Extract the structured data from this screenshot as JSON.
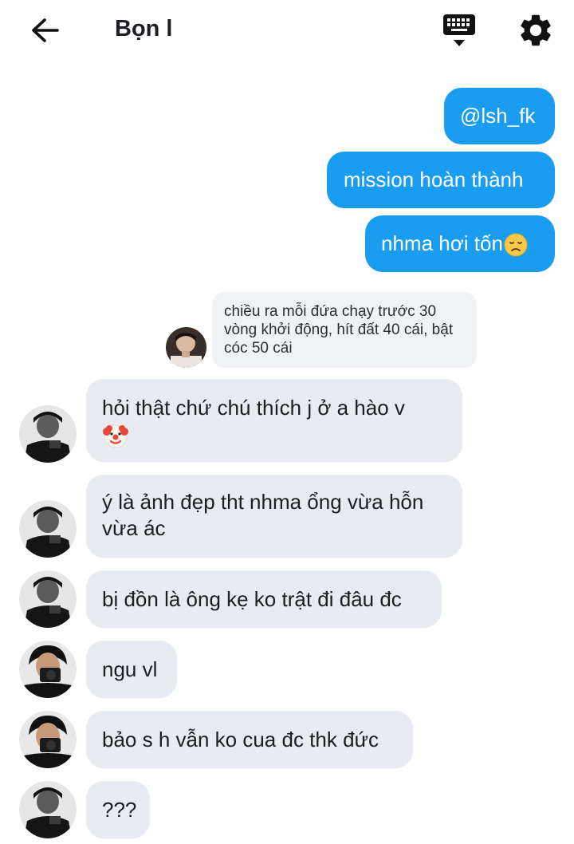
{
  "header": {
    "title": "Bọn l"
  },
  "messages": {
    "outgoing": [
      {
        "text": "@lsh_fk"
      },
      {
        "text": "mission hoàn thành"
      },
      {
        "text": "nhma hơi tốn",
        "emoji": "disappointed-face"
      }
    ],
    "reply_preview": {
      "text": "chiều ra mỗi đứa chạy trước 30 vòng khởi động, hít đất 40 cái, bật cóc 50 cái"
    },
    "incoming": [
      {
        "text": "hỏi thật chứ chú thích j ở a hào v",
        "emoji": "clown-face"
      },
      {
        "text": "ý là ảnh đẹp tht nhma ổng vừa hỗn vừa ác"
      },
      {
        "text": "bị đồn là ông kẹ ko trật đi đâu đc"
      },
      {
        "text": "ngu vl"
      },
      {
        "text": "bảo s h vẫn ko cua đc thk đức"
      },
      {
        "text": "???"
      }
    ]
  },
  "colors": {
    "outgoing_bubble": "#1a9df0",
    "incoming_bubble": "#e8ebef"
  }
}
